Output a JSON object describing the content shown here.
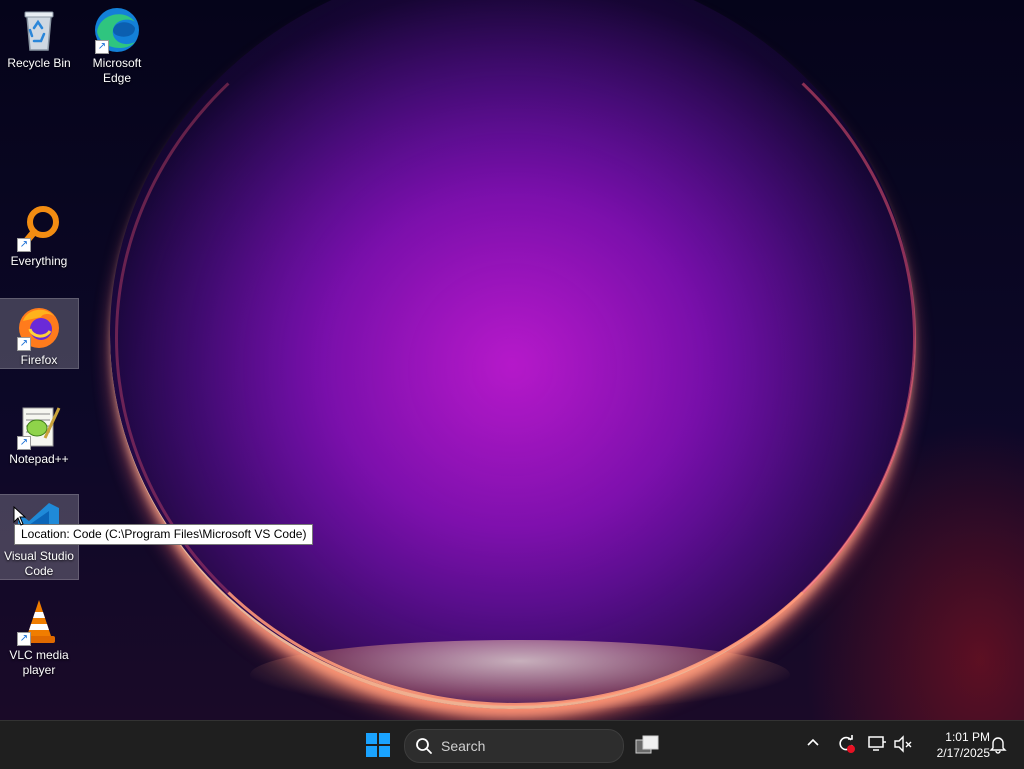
{
  "desktop_icons": [
    {
      "label": "Recycle Bin",
      "icon": "recycle-bin-icon"
    },
    {
      "label": "Microsoft Edge",
      "icon": "edge-icon"
    },
    {
      "label": "Everything",
      "icon": "everything-search-icon"
    },
    {
      "label": "Firefox",
      "icon": "firefox-icon"
    },
    {
      "label": "Notepad++",
      "icon": "notepad-plus-plus-icon"
    },
    {
      "label": "Visual Studio Code",
      "icon": "vscode-icon"
    },
    {
      "label": "VLC media player",
      "icon": "vlc-icon"
    }
  ],
  "tooltip": "Location: Code (C:\\Program Files\\Microsoft VS Code)",
  "taskbar": {
    "search_label": "Search",
    "time": "1:01 PM",
    "date": "2/17/2025"
  },
  "colors": {
    "taskbar_bg": "#1f1f1f",
    "windows_blue": "#1aa3ff",
    "accent_magenta": "#b414c8"
  }
}
